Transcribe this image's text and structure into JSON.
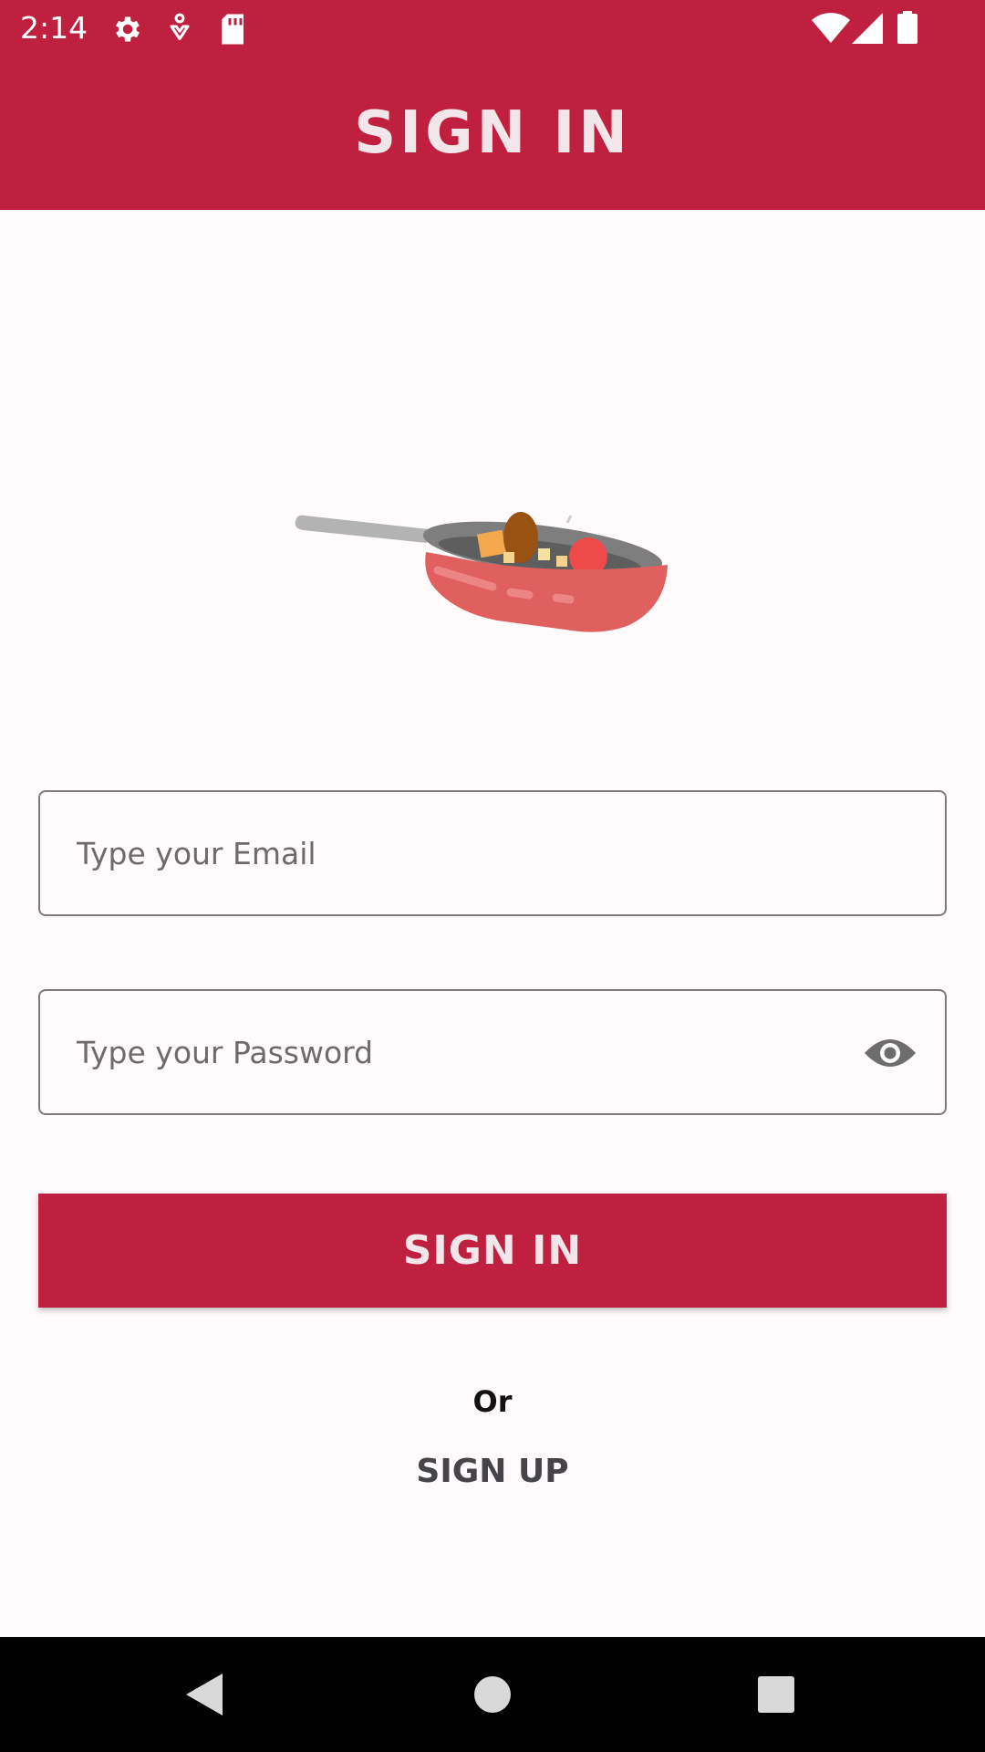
{
  "status_bar": {
    "time": "2:14",
    "icons": [
      "gear-icon",
      "accessibility-icon",
      "sd-card-icon",
      "wifi-icon",
      "cellular-signal-icon",
      "battery-icon"
    ]
  },
  "app_bar": {
    "title": "SIGN IN"
  },
  "illustration": {
    "description_icon": "cooking-pan-illustration"
  },
  "form": {
    "email": {
      "placeholder": "Type your Email",
      "value": ""
    },
    "password": {
      "placeholder": "Type your Password",
      "value": "",
      "toggle_icon": "eye-icon"
    },
    "sign_in_label": "SIGN IN",
    "or_label": "Or",
    "sign_up_label": "SIGN UP"
  },
  "nav_bar": {
    "icons": [
      "back-icon",
      "home-icon",
      "recents-icon"
    ]
  },
  "colors": {
    "primary": "#BF2040",
    "on_primary": "#F3E6EA",
    "background": "#FFFBFD",
    "outline": "#7D7A7D",
    "pan": "#E06060"
  }
}
